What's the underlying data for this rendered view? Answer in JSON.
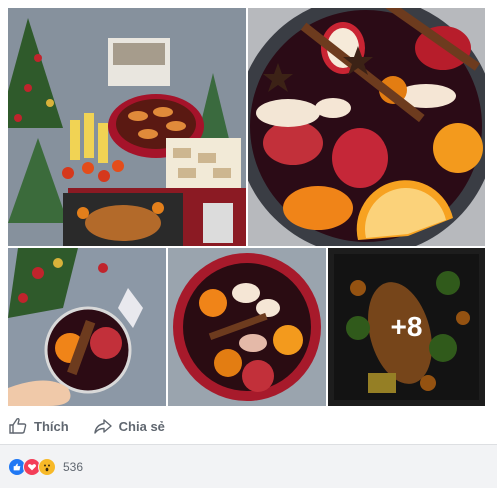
{
  "photos": {
    "remaining_count_label": "+8"
  },
  "actions": {
    "like_label": "Thích",
    "share_label": "Chia sẻ"
  },
  "reactions": {
    "icons": [
      "like-icon",
      "love-icon",
      "wow-icon"
    ],
    "colors": {
      "like": "#2078f4",
      "love": "#f33e58",
      "wow": "#f7b928"
    },
    "count": "536"
  }
}
